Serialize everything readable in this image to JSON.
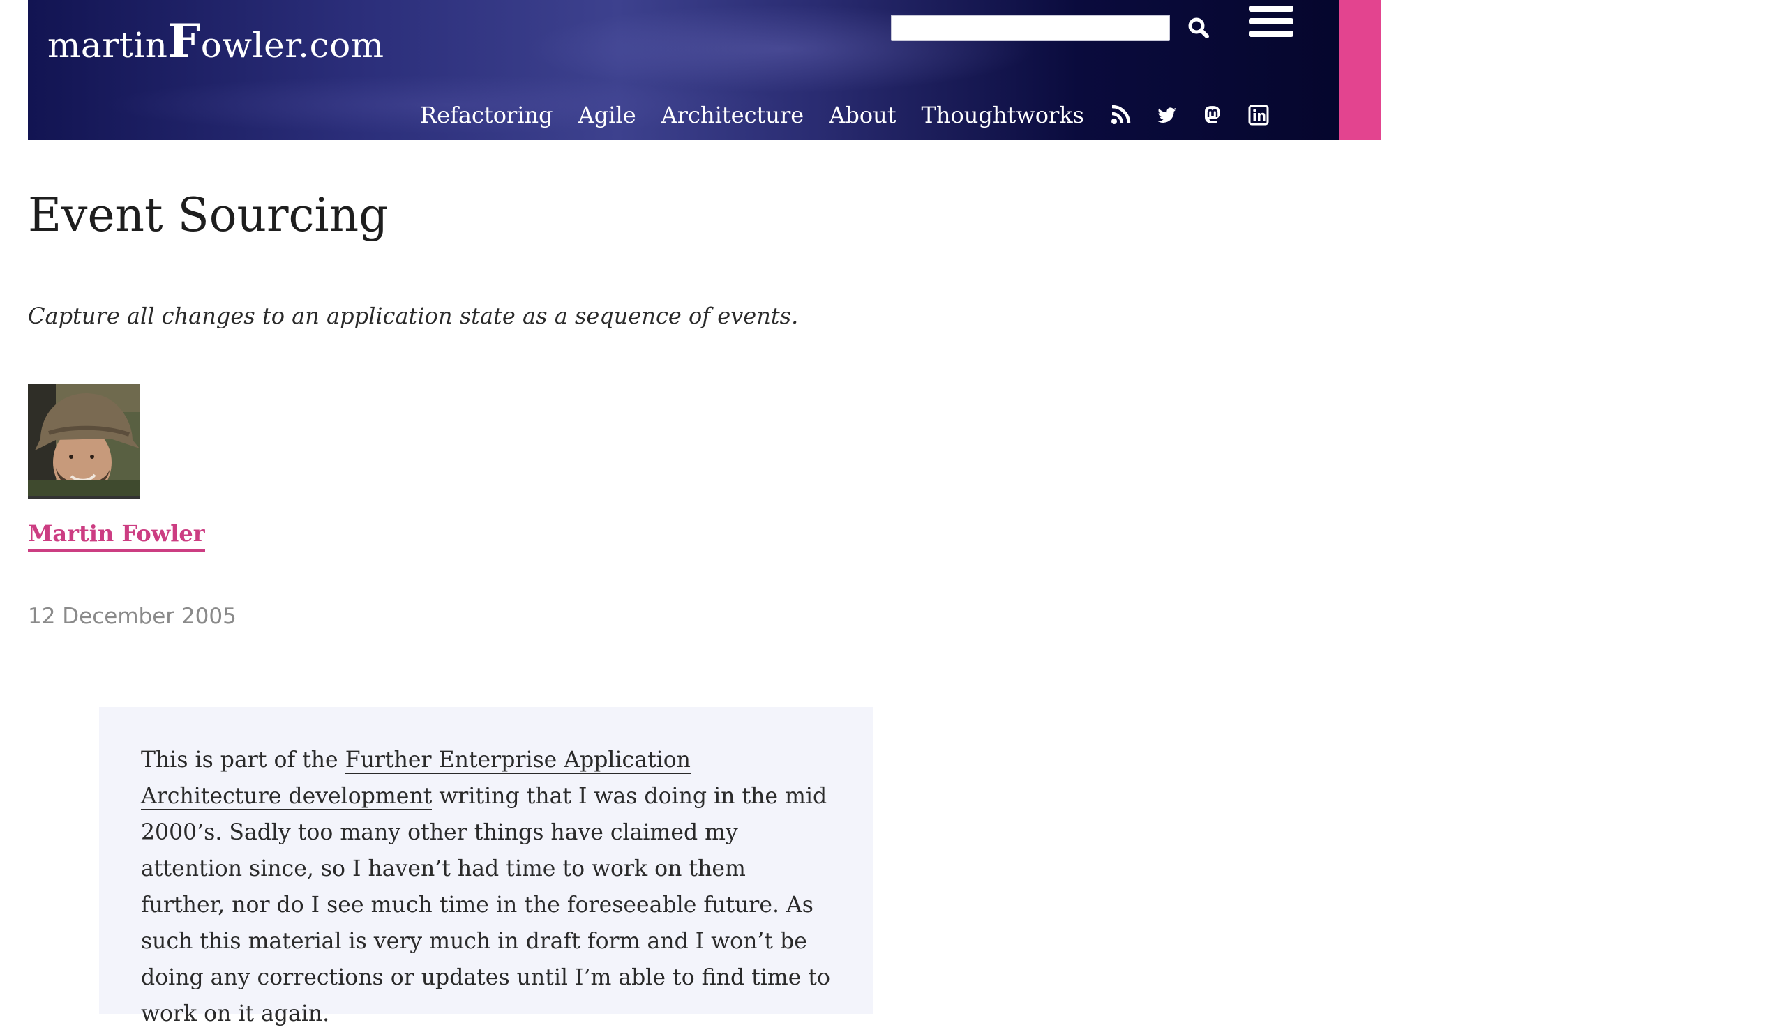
{
  "header": {
    "logo_prefix": "martin",
    "logo_big_letter": "F",
    "logo_suffix": "owler.com",
    "search": {
      "placeholder": "",
      "value": ""
    },
    "nav": [
      {
        "label": "Refactoring"
      },
      {
        "label": "Agile"
      },
      {
        "label": "Architecture"
      },
      {
        "label": "About"
      },
      {
        "label": "Thoughtworks"
      }
    ],
    "social_icons": [
      "rss-icon",
      "twitter-icon",
      "mastodon-icon",
      "linkedin-icon"
    ],
    "accent_color": "#e3448f"
  },
  "article": {
    "title": "Event Sourcing",
    "subtitle": "Capture all changes to an application state as a sequence of events.",
    "author": "Martin Fowler",
    "date": "12 December 2005",
    "author_color": "#cc3d82"
  },
  "notice": {
    "text_before": "This is part of the ",
    "link_text": "Further Enterprise Application Architecture development",
    "text_after": " writing that I was doing in the mid 2000’s. Sadly too many other things have claimed my attention since, so I haven’t had time to work on them further, nor do I see much time in the foreseeable future. As such this material is very much in draft form and I won’t be doing any corrections or updates until I’m able to find time to work on it again."
  }
}
